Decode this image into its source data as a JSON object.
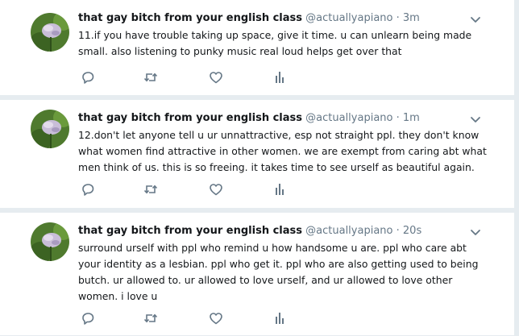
{
  "colors": {
    "background": "#e6ecf0",
    "card": "#ffffff",
    "text": "#14171a",
    "muted": "#657786",
    "icon": "#657786"
  },
  "tweets": [
    {
      "display_name": "that gay bitch from your english class",
      "handle": "@actuallyapiano",
      "separator": "·",
      "time": "3m",
      "lines": [
        "11.if you have trouble taking up space, give it time. u can unlearn being made",
        "small. also listening to punky music real loud helps get over that"
      ]
    },
    {
      "display_name": "that gay bitch from your english class",
      "handle": "@actuallyapiano",
      "separator": "·",
      "time": "1m",
      "lines": [
        "12.don't let anyone tell u ur unnattractive, esp not straight ppl. they don't know",
        "what women find attractive in other women. we are exempt from caring abt what",
        "men think of us. this is so freeing. it takes time to see urself as beautiful again."
      ]
    },
    {
      "display_name": "that gay bitch from your english class",
      "handle": "@actuallyapiano",
      "separator": "·",
      "time": "20s",
      "lines": [
        "surround urself with ppl who remind u how handsome u are. ppl who care abt",
        "your identity as a lesbian. ppl who get it. ppl who are also getting used to being",
        "butch. ur allowed to. ur allowed to love urself, and ur allowed to love other",
        "women. i love u"
      ]
    }
  ],
  "icons": {
    "reply": "reply-icon",
    "retweet": "retweet-icon",
    "like": "heart-icon",
    "analytics": "analytics-icon",
    "more": "chevron-down-icon"
  }
}
